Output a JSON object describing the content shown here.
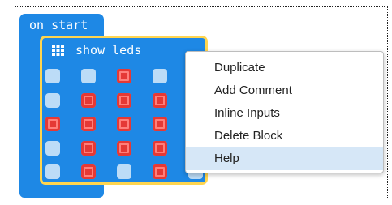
{
  "on_start": {
    "label": "on start"
  },
  "show_leds": {
    "label": "show leds",
    "icon": "grid-icon"
  },
  "led_grid": [
    [
      "off",
      "off",
      "on",
      "off",
      "off"
    ],
    [
      "off",
      "on",
      "on",
      "on",
      "off"
    ],
    [
      "on",
      "on",
      "on",
      "on",
      "on"
    ],
    [
      "off",
      "on",
      "on",
      "on",
      "off"
    ],
    [
      "off",
      "on",
      "off",
      "on",
      "off"
    ]
  ],
  "context_menu": {
    "items": [
      "Duplicate",
      "Add Comment",
      "Inline Inputs",
      "Delete Block",
      "Help"
    ],
    "highlighted": "Help"
  },
  "colors": {
    "block_blue": "#1e88e5",
    "selection_yellow": "#ffd54f",
    "led_on": "#e53935",
    "led_off": "#bcdcf7",
    "menu_highlight": "#d6e7f7"
  }
}
